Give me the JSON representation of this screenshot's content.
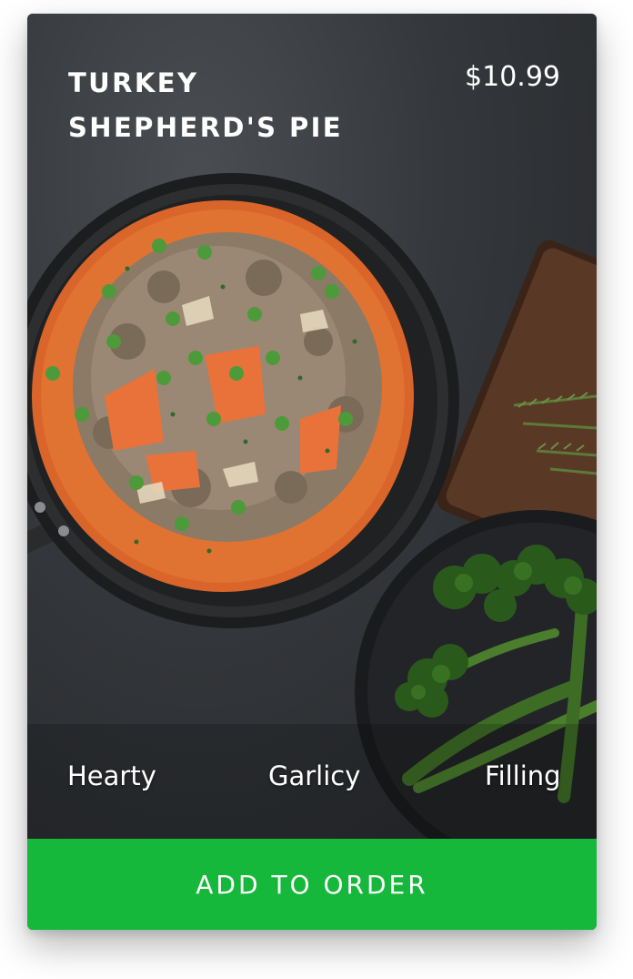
{
  "product": {
    "title_line1": "TURKEY",
    "title_line2": "SHEPHERD'S PIE",
    "price": "$10.99",
    "image_name": "dish-photo"
  },
  "tags": [
    "Hearty",
    "Garlicy",
    "Filling"
  ],
  "actions": {
    "add_label": "ADD TO ORDER"
  },
  "colors": {
    "button": "#16b83b",
    "text": "#ffffff",
    "background": "#2c2f33"
  }
}
